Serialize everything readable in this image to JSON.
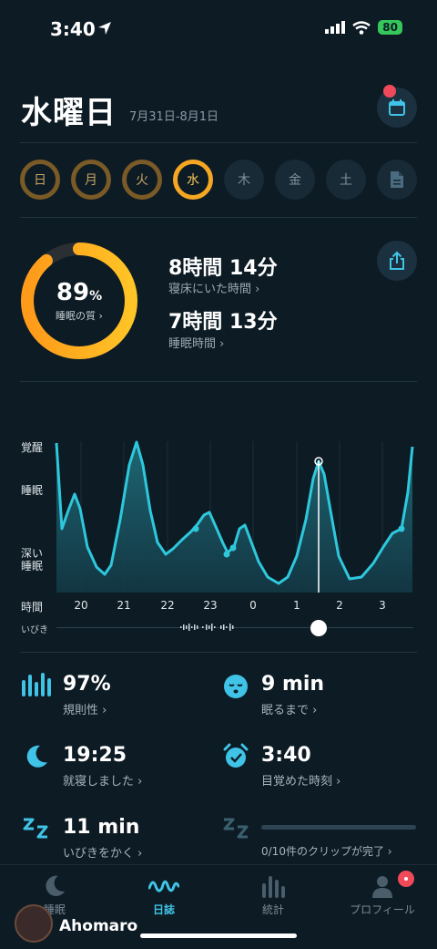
{
  "status_bar": {
    "time": "3:40",
    "battery": "80"
  },
  "header": {
    "title": "水曜日",
    "date_range": "7月31日-8月1日"
  },
  "days": [
    {
      "label": "日",
      "state": "past"
    },
    {
      "label": "月",
      "state": "past"
    },
    {
      "label": "火",
      "state": "past"
    },
    {
      "label": "水",
      "state": "today"
    },
    {
      "label": "木",
      "state": "future"
    },
    {
      "label": "金",
      "state": "future"
    },
    {
      "label": "土",
      "state": "future"
    }
  ],
  "summary": {
    "quality_value": "89",
    "quality_unit": "%",
    "quality_label": "睡眠の質 ›",
    "quality_fraction": 0.89,
    "in_bed_value": "8時間 14分",
    "in_bed_label": "寝床にいた時間 ›",
    "asleep_value": "7時間 13分",
    "asleep_label": "睡眠時間 ›"
  },
  "chart": {
    "y_labels": {
      "awake": "覚醒",
      "sleep": "睡眠",
      "deep_1": "深い",
      "deep_2": "睡眠"
    },
    "x_title": "時間",
    "x_ticks": [
      "20",
      "21",
      "22",
      "23",
      "0",
      "1",
      "2",
      "3"
    ],
    "snore_label": "いびき",
    "colors": {
      "line": "#2ec8dd",
      "fill": "#1d5663"
    }
  },
  "stats": {
    "regularity_value": "97%",
    "regularity_label": "規則性 ›",
    "fall_asleep_value": "9 min",
    "fall_asleep_label": "眠るまで ›",
    "bedtime_value": "19:25",
    "bedtime_label": "就寝しました ›",
    "wakeup_value": "3:40",
    "wakeup_label": "目覚めた時刻 ›",
    "snoring_value": "11 min",
    "snoring_label": "いびきをかく ›",
    "clips_label": "0/10件のクリップが完了 ›",
    "clips_progress": 0
  },
  "nav": {
    "items": [
      {
        "label": "睡眠",
        "active": false
      },
      {
        "label": "日誌",
        "active": true
      },
      {
        "label": "統計",
        "active": false
      },
      {
        "label": "プロフィール",
        "active": false
      }
    ]
  },
  "watermark": "Ahomaro"
}
